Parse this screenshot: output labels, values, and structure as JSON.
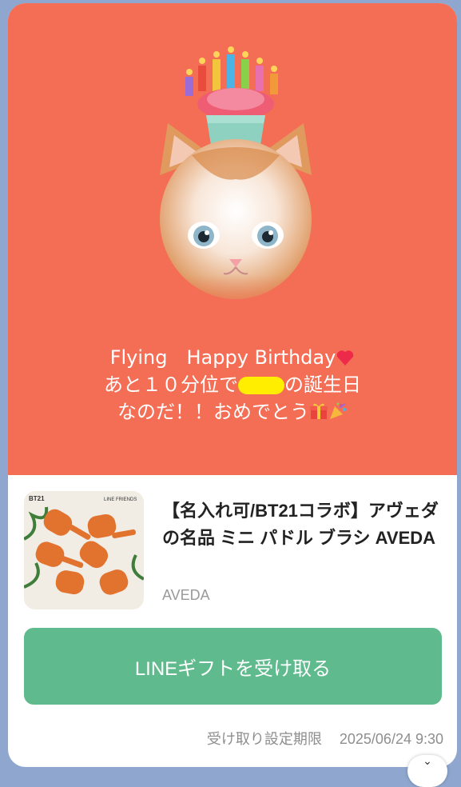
{
  "message": {
    "line1": "Flying　Happy Birthday",
    "line2_before": "あと１０分位で",
    "line2_after": "の誕生日",
    "line3": "なのだ！！おめでとう",
    "icons": [
      "heart-icon",
      "gift-icon",
      "party-popper-icon"
    ]
  },
  "product": {
    "title": "【名入れ可/BT21コラボ】アヴェダの名品 ミニ パドル ブラシ AVEDA",
    "brand": "AVEDA",
    "thumb_labels": {
      "left": "BT21",
      "right": "LINE FRIENDS"
    }
  },
  "gift_button": {
    "label": "LINEギフトを受け取る"
  },
  "footer": {
    "deadline_label": "受け取り設定期限",
    "deadline_value": "2025/06/24 9:30"
  },
  "colors": {
    "hero_bg": "#f36e55",
    "button": "#5fba8d",
    "page_bg": "#8fa7cf"
  }
}
